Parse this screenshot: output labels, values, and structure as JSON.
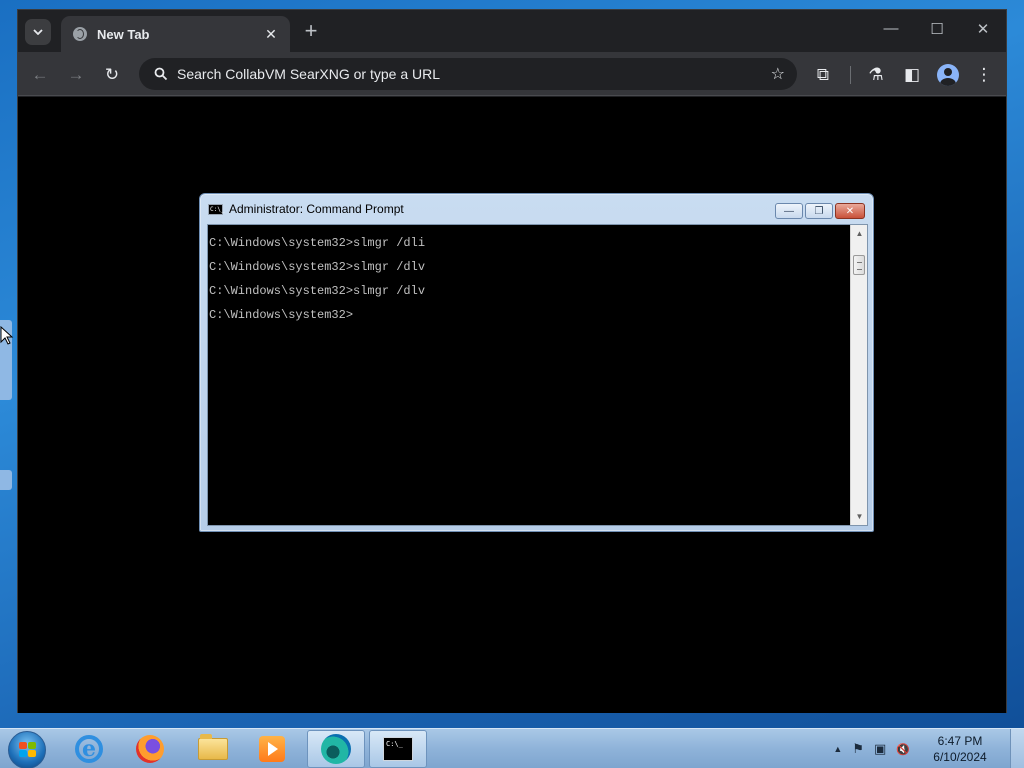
{
  "browser": {
    "tab": {
      "title": "New Tab"
    },
    "new_tab_label": "+",
    "window_controls": {
      "minimize": "—",
      "maximize": "☐",
      "close": "✕"
    },
    "toolbar": {
      "back": "←",
      "forward": "→",
      "reload": "↻",
      "omnibox_placeholder": "Search CollabVM SearXNG or type a URL",
      "star": "☆",
      "extensions": "⧉",
      "labs": "⚗",
      "sidepanel": "◧",
      "menu": "⋮"
    }
  },
  "cmd": {
    "title": "Administrator:  Command Prompt",
    "icon_text": "C:\\_",
    "buttons": {
      "minimize": "—",
      "restore": "❐",
      "close": "✕"
    },
    "lines": [
      "C:\\Windows\\system32>slmgr /dli",
      "C:\\Windows\\system32>slmgr /dlv",
      "C:\\Windows\\system32>slmgr /dlv",
      "C:\\Windows\\system32>"
    ],
    "scroll": {
      "up": "▲",
      "down": "▼"
    }
  },
  "taskbar": {
    "apps": [
      "internet-explorer",
      "firefox",
      "file-explorer",
      "media-player",
      "edge",
      "command-prompt"
    ],
    "cmd_icon_text": "C:\\_",
    "tray": {
      "chevron": "▲",
      "flag": "⚑",
      "network": "▣",
      "volume": "🔇"
    },
    "clock": {
      "time": "6:47 PM",
      "date": "6/10/2024"
    }
  },
  "colors": {
    "browser_bg": "#202124",
    "toolbar_bg": "#35363a",
    "console_text": "#c0c0c0",
    "taskbar": "#8fb3d9"
  }
}
